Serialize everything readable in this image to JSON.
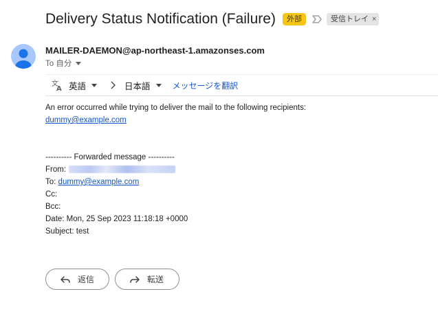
{
  "email": {
    "subject": "Delivery Status Notification (Failure)",
    "external_badge": "外部",
    "inbox_label": "受信トレイ",
    "inbox_label_close": "×",
    "sender": "MAILER-DAEMON@ap-northeast-1.amazonses.com",
    "to_me": "To 自分"
  },
  "translate": {
    "source_lang": "英語",
    "target_lang": "日本語",
    "translate_link": "メッセージを翻訳"
  },
  "body": {
    "line1": "An error occurred while trying to deliver the mail to the following recipients:",
    "recipient_link": "dummy@example.com",
    "forwarded_header": "---------- Forwarded message ----------",
    "from_label": "From:",
    "to_label": "To:",
    "to_link": "dummy@example.com",
    "cc_label": "Cc:",
    "bcc_label": "Bcc:",
    "date_line": "Date: Mon, 25 Sep 2023 11:18:18 +0000",
    "subject_line": "Subject: test"
  },
  "actions": {
    "reply": "返信",
    "forward": "転送"
  },
  "colors": {
    "external_badge": "#f5c518",
    "avatar": "#a8c7fa",
    "link": "#1155cc"
  }
}
